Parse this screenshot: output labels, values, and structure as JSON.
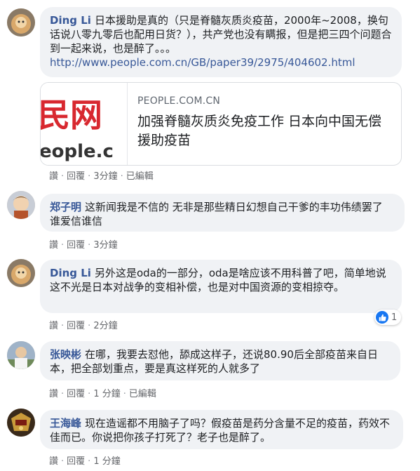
{
  "comments": [
    {
      "author": "Ding Li",
      "text": "日本援助是真的（只是脊髓灰质炎疫苗，2000年~2008，换句话说八零九零后也配用日货？），共产党也没有瞒报，但是把三四个问题合到一起来说，也是醉了。。。",
      "link": "http://www.people.com.cn/GB/paper39/2975/404602.html",
      "card": {
        "thumb_text_top": "民网",
        "thumb_text_bottom": "eople.c",
        "domain": "PEOPLE.COM.CN",
        "title": "加强脊髓灰质炎免疫工作 日本向中国无偿援助疫苗"
      },
      "actions": {
        "like": "讚",
        "reply": "回覆",
        "time": "3分鐘",
        "edited": "已編輯"
      }
    },
    {
      "author": "郑子明",
      "text": "这新闻我是不信的 无非是那些精日幻想自己干爹的丰功伟绩罢了 谁爱信谁信",
      "actions": {
        "like": "讚",
        "reply": "回覆",
        "time": "3分鐘"
      }
    },
    {
      "author": "Ding Li",
      "text": "另外这是oda的一部分，oda是啥应该不用科普了吧，简单地说这不光是日本对战争的变相补偿，也是对中国资源的变相掠夺。",
      "actions": {
        "like": "讚",
        "reply": "回覆",
        "time": "2分鐘"
      },
      "reaction_count": "1"
    },
    {
      "author": "张映彬",
      "text": "在哪，我要去怼他，舔成这样子，还说80.90后全部疫苗来自日本，把全部划重点，要是真这样死的人就多了",
      "actions": {
        "like": "讚",
        "reply": "回覆",
        "time": "1 分鐘",
        "edited": "已編輯"
      }
    },
    {
      "author": "王海峰",
      "text": "现在造谣都不用脑子了吗？假疫苗是药分含量不足的疫苗，药效不佳而已。你说把你孩子打死了？老子也是醉了。",
      "actions": {
        "like": "讚",
        "reply": "回覆",
        "time": "1 分鐘"
      }
    }
  ],
  "colors": {
    "author": "#385898",
    "bubble": "#f0f2f5",
    "like": "#1877f2"
  },
  "icons": {
    "reaction": "thumbs-up-icon"
  }
}
